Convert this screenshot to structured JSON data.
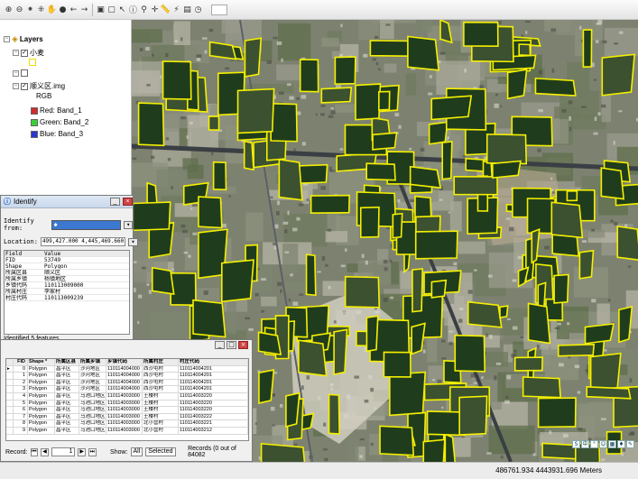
{
  "toolbar": {
    "icons": [
      "zoom-in-icon",
      "zoom-out-icon",
      "fixed-zoom-in-icon",
      "fixed-zoom-out-icon",
      "pan-icon",
      "full-extent-icon",
      "back-extent-icon",
      "forward-extent-icon",
      "select-features-icon",
      "clear-selection-icon",
      "select-elements-icon",
      "identify-icon",
      "find-icon",
      "go-to-xy-icon",
      "measure-icon",
      "hyperlink-icon",
      "html-popup-icon",
      "time-slider-icon"
    ]
  },
  "toc": {
    "root": "Layers",
    "layer1": "小麦",
    "layer2_checkbox": "",
    "layer3": "顺义区.img",
    "rgb": "RGB",
    "bands": [
      {
        "label": "Red:   Band_1",
        "color": "#d42a2a"
      },
      {
        "label": "Green: Band_2",
        "color": "#38d038"
      },
      {
        "label": "Blue:  Band_3",
        "color": "#2a36d4"
      }
    ]
  },
  "identify": {
    "title": "Identify",
    "from_label": "Identify from:",
    "location_label": "Location:",
    "location_value": "499,427.000  4,445,469.660 Mete",
    "field_header": "Field",
    "value_header": "Value",
    "rows": [
      {
        "field": "FID",
        "value": "53749"
      },
      {
        "field": "Shape",
        "value": "Polygon"
      },
      {
        "field": "所属区县",
        "value": "顺义区"
      },
      {
        "field": "所属乡镇",
        "value": "杨镇地区"
      },
      {
        "field": "乡镇代码",
        "value": "110113009000"
      },
      {
        "field": "所属村庄",
        "value": "李家村"
      },
      {
        "field": "村庄代码",
        "value": "110113009239"
      }
    ],
    "status": "Identified 5 features"
  },
  "attr_table": {
    "headers": [
      "",
      "FID",
      "Shape *",
      "所属区县",
      "所属乡镇",
      "乡镇代码",
      "所属村庄",
      "村庄代码"
    ],
    "rows": [
      [
        "▸",
        "0",
        "Polygon",
        "昌平区",
        "沙河地区",
        "110114004000",
        "西沙屯村",
        "110114004201"
      ],
      [
        "",
        "1",
        "Polygon",
        "昌平区",
        "沙河地区",
        "110114004000",
        "西沙屯村",
        "110114004201"
      ],
      [
        "",
        "2",
        "Polygon",
        "昌平区",
        "沙河地区",
        "110114004000",
        "西沙屯村",
        "110114004201"
      ],
      [
        "",
        "3",
        "Polygon",
        "昌平区",
        "沙河地区",
        "110114004000",
        "西沙屯村",
        "110114004201"
      ],
      [
        "",
        "4",
        "Polygon",
        "昌平区",
        "马池口地区",
        "110114003000",
        "土楼村",
        "110114003220"
      ],
      [
        "",
        "5",
        "Polygon",
        "昌平区",
        "马池口地区",
        "110114003000",
        "土楼村",
        "110114003220"
      ],
      [
        "",
        "6",
        "Polygon",
        "昌平区",
        "马池口地区",
        "110114003000",
        "土楼村",
        "110114003220"
      ],
      [
        "",
        "7",
        "Polygon",
        "昌平区",
        "马池口地区",
        "110114003000",
        "土楼村",
        "110114003222"
      ],
      [
        "",
        "8",
        "Polygon",
        "昌平区",
        "马池口地区",
        "110114003000",
        "北小营村",
        "110114003221"
      ],
      [
        "",
        "9",
        "Polygon",
        "昌平区",
        "马池口地区",
        "110114003000",
        "北小营村",
        "110114003212"
      ]
    ],
    "record_label": "Record:",
    "record_value": "1",
    "show_label": "Show:",
    "all_label": "All",
    "selected_label": "Selected",
    "records_text": "Records (0 out of 84082"
  },
  "status": {
    "coords": "486761.934  4443931.696 Meters"
  },
  "colors": {
    "field_outline": "#f5ef00",
    "field_fill": "#1f3d1c"
  }
}
